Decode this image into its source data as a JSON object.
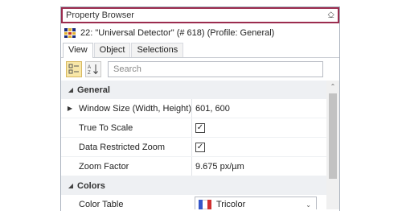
{
  "panel": {
    "title": "Property Browser",
    "pin_glyph": "⎐",
    "object_line": "22: \"Universal Detector\" (# 618) (Profile: General)"
  },
  "tabs": [
    {
      "label": "View",
      "active": true
    },
    {
      "label": "Object",
      "active": false
    },
    {
      "label": "Selections",
      "active": false
    }
  ],
  "toolbar": {
    "search_placeholder": "Search",
    "categorized_icon": "categorized-icon",
    "alphabetical_icon": "sort-az-icon"
  },
  "categories": [
    {
      "label": "General",
      "rows": [
        {
          "name": "Window Size (Width, Height)",
          "value": "601, 600",
          "expandable": true
        },
        {
          "name": "True To Scale",
          "check": "✓"
        },
        {
          "name": "Data Restricted Zoom",
          "check": "✓"
        },
        {
          "name": "Zoom Factor",
          "value": "9.675 px/µm"
        }
      ]
    },
    {
      "label": "Colors",
      "rows": [
        {
          "name": "Color Table",
          "value": "Tricolor",
          "swatch_colors": [
            "#3455c8",
            "#ffffff",
            "#d03030"
          ]
        }
      ]
    }
  ],
  "colors": {
    "title_border": "#9b2c4e",
    "active_tool": "#f8e7a8"
  }
}
